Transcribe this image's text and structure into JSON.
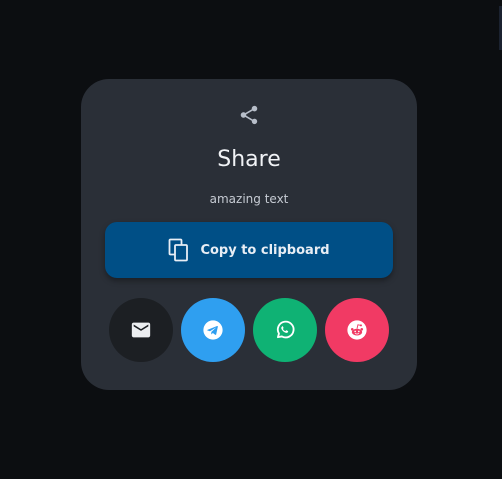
{
  "dialog": {
    "title": "Share",
    "subtitle": "amazing text",
    "copy_label": "Copy to clipboard"
  },
  "share_targets": [
    {
      "name": "email",
      "icon": "email-icon",
      "color": "#1c1f23"
    },
    {
      "name": "telegram",
      "icon": "telegram-icon",
      "color": "#2f9ff0"
    },
    {
      "name": "whatsapp",
      "icon": "whatsapp-icon",
      "color": "#0fb274"
    },
    {
      "name": "reddit",
      "icon": "reddit-icon",
      "color": "#f13a64"
    }
  ],
  "colors": {
    "background": "#0c0e11",
    "card": "#2a2f37",
    "copy_button": "#004f86"
  }
}
